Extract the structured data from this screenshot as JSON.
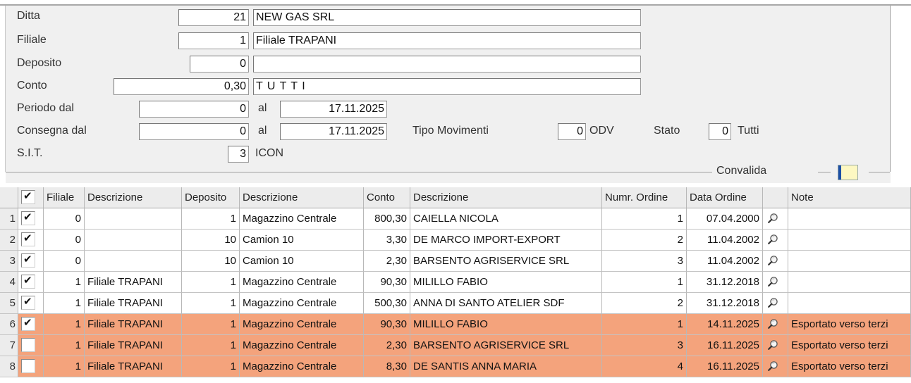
{
  "form": {
    "ditta": {
      "label": "Ditta",
      "code": "21",
      "name": "NEW GAS SRL"
    },
    "filiale": {
      "label": "Filiale",
      "code": "1",
      "name": "Filiale TRAPANI"
    },
    "deposito": {
      "label": "Deposito",
      "code": "0",
      "name": ""
    },
    "conto": {
      "label": "Conto",
      "code": "0,30",
      "name": "T U T T I"
    },
    "periodo": {
      "label": "Periodo dal",
      "from": "0",
      "al_label": "al",
      "to": "17.11.2025"
    },
    "consegna": {
      "label": "Consegna dal",
      "from": "0",
      "al_label": "al",
      "to": "17.11.2025"
    },
    "tipo_movimenti": {
      "label": "Tipo Movimenti",
      "value": "0",
      "text": "ODV"
    },
    "stato": {
      "label": "Stato",
      "value": "0",
      "text": "Tutti"
    },
    "sit": {
      "label": "S.I.T.",
      "value": "3",
      "text": "ICON"
    },
    "convalida": {
      "label": "Convalida"
    }
  },
  "table": {
    "headers": [
      "",
      "Filiale",
      "Descrizione",
      "Deposito",
      "Descrizione",
      "Conto",
      "Descrizione",
      "Numr. Ordine",
      "Data Ordine",
      "",
      "Note"
    ],
    "rows": [
      {
        "n": "1",
        "checked": true,
        "filiale": "0",
        "fdesc": "",
        "deposito": "1",
        "ddesc": "Magazzino Centrale",
        "conto": "800,30",
        "cdesc": "CAIELLA NICOLA",
        "numr": "1",
        "data": "07.04.2000",
        "note": "",
        "highlight": false
      },
      {
        "n": "2",
        "checked": true,
        "filiale": "0",
        "fdesc": "",
        "deposito": "10",
        "ddesc": "Camion 10",
        "conto": "3,30",
        "cdesc": "DE MARCO IMPORT-EXPORT",
        "numr": "2",
        "data": "11.04.2002",
        "note": "",
        "highlight": false
      },
      {
        "n": "3",
        "checked": true,
        "filiale": "0",
        "fdesc": "",
        "deposito": "10",
        "ddesc": "Camion 10",
        "conto": "2,30",
        "cdesc": "BARSENTO AGRISERVICE SRL",
        "numr": "3",
        "data": "11.04.2002",
        "note": "",
        "highlight": false
      },
      {
        "n": "4",
        "checked": true,
        "filiale": "1",
        "fdesc": "Filiale TRAPANI",
        "deposito": "1",
        "ddesc": "Magazzino Centrale",
        "conto": "90,30",
        "cdesc": "MILILLO FABIO",
        "numr": "1",
        "data": "31.12.2018",
        "note": "",
        "highlight": false
      },
      {
        "n": "5",
        "checked": true,
        "filiale": "1",
        "fdesc": "Filiale TRAPANI",
        "deposito": "1",
        "ddesc": "Magazzino Centrale",
        "conto": "500,30",
        "cdesc": "ANNA DI SANTO ATELIER SDF",
        "numr": "2",
        "data": "31.12.2018",
        "note": "",
        "highlight": false
      },
      {
        "n": "6",
        "checked": true,
        "filiale": "1",
        "fdesc": "Filiale TRAPANI",
        "deposito": "1",
        "ddesc": "Magazzino Centrale",
        "conto": "90,30",
        "cdesc": "MILILLO FABIO",
        "numr": "1",
        "data": "14.11.2025",
        "note": "Esportato verso terzi",
        "highlight": true
      },
      {
        "n": "7",
        "checked": false,
        "filiale": "1",
        "fdesc": "Filiale TRAPANI",
        "deposito": "1",
        "ddesc": "Magazzino Centrale",
        "conto": "2,30",
        "cdesc": "BARSENTO AGRISERVICE SRL",
        "numr": "3",
        "data": "16.11.2025",
        "note": "Esportato verso terzi",
        "highlight": true
      },
      {
        "n": "8",
        "checked": false,
        "filiale": "1",
        "fdesc": "Filiale TRAPANI",
        "deposito": "1",
        "ddesc": "Magazzino Centrale",
        "conto": "8,30",
        "cdesc": "DE SANTIS ANNA MARIA",
        "numr": "4",
        "data": "16.11.2025",
        "note": "Esportato verso terzi",
        "highlight": true
      }
    ]
  },
  "colors": {
    "highlight_row": "#f4a37c",
    "panel_bg": "#f0f0f0",
    "header_bg": "#ececec"
  },
  "icons": {
    "row_detail": "magnifier-icon",
    "convalida_toggle": "color-swatch-icon"
  }
}
